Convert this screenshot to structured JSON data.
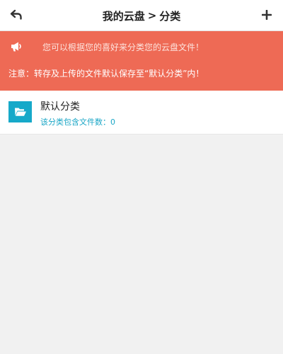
{
  "header": {
    "title_part1": "我的云盘",
    "separator": ">",
    "title_part2": "分类"
  },
  "notice": {
    "line1": "您可以根据您的喜好来分类您的云盘文件！",
    "line2": "注意：转存及上传的文件默认保存至“默认分类”内！",
    "bg_color": "#ee6a55"
  },
  "categories": [
    {
      "name": "默认分类",
      "count_label": "该分类包含文件数：0",
      "icon": "folder-open-icon",
      "icon_color": "#16a9c9"
    }
  ]
}
